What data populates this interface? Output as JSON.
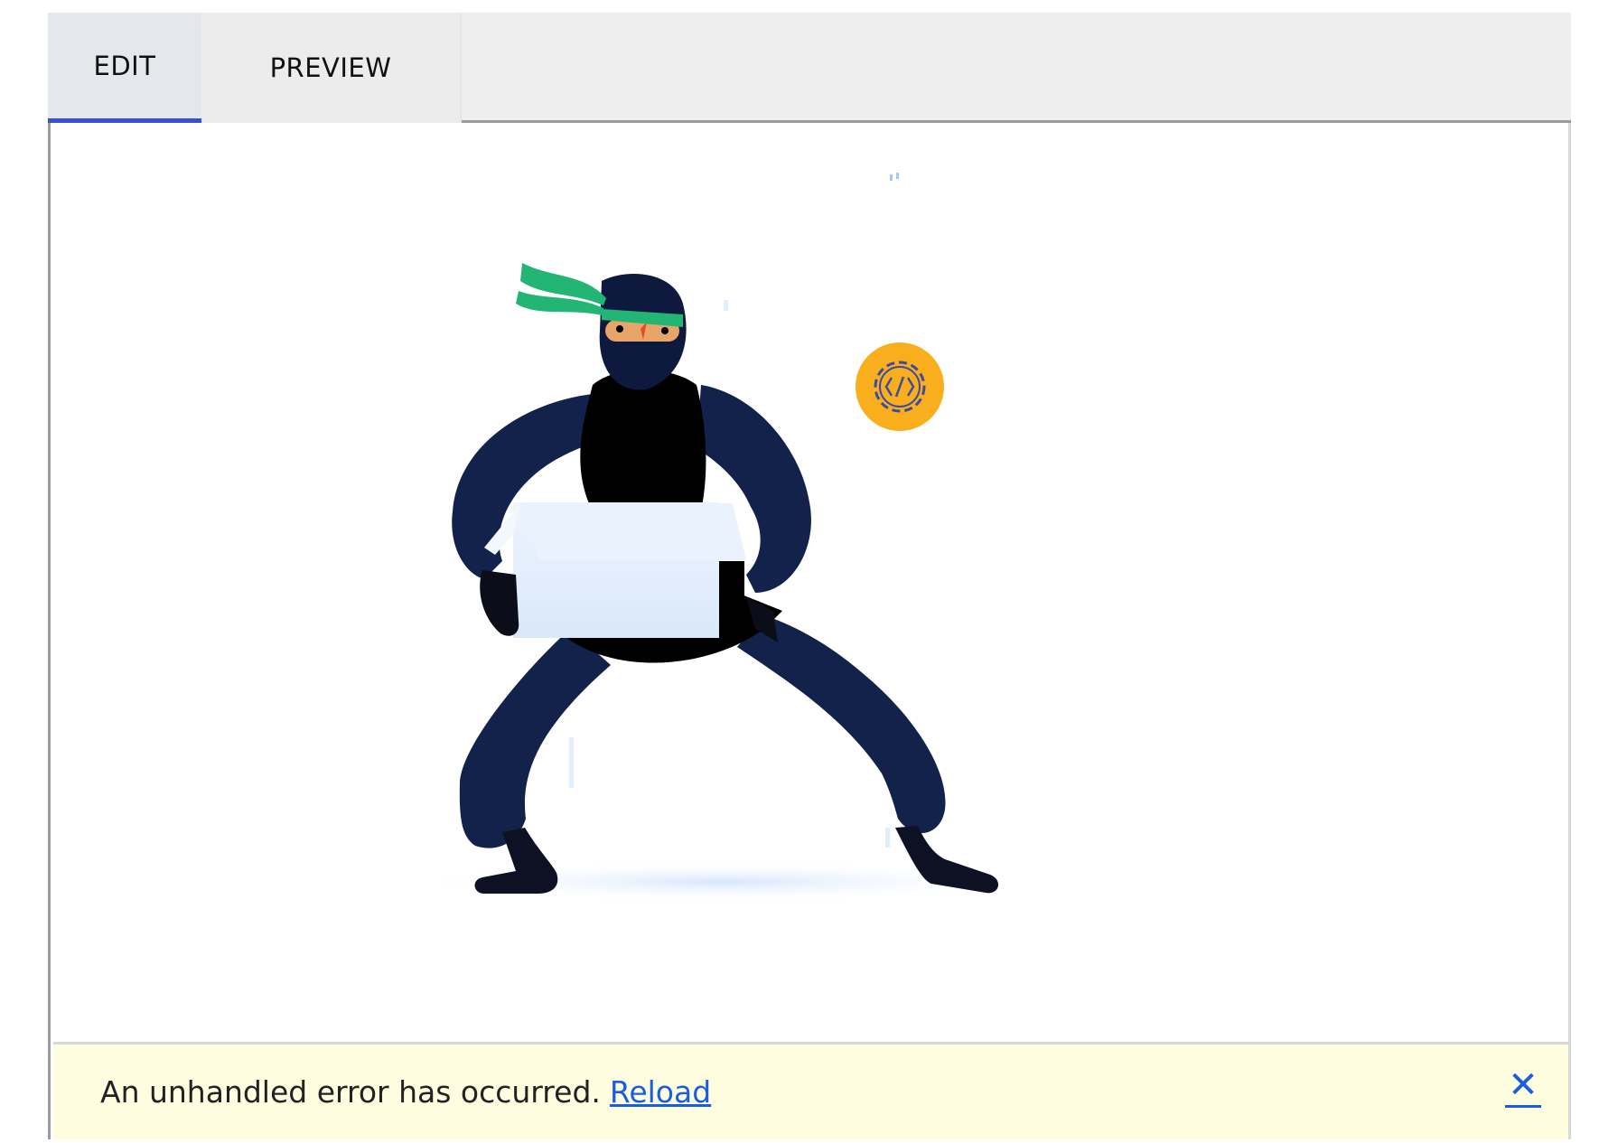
{
  "tabs": [
    {
      "label": "EDIT",
      "active": true
    },
    {
      "label": "PREVIEW",
      "active": false
    }
  ],
  "illustration": {
    "subject": "ninja-carrying-box",
    "badge_icon": "code-gear-icon"
  },
  "error": {
    "message": "An unhandled error has occurred.",
    "reload_label": "Reload",
    "dismiss_glyph": "✕"
  },
  "colors": {
    "accent": "#3b4fd6",
    "link": "#1a5ee0",
    "error_background": "#fffde0",
    "ninja_body": "#13224a",
    "ninja_headband": "#22b573",
    "badge": "#f9ae1e"
  }
}
